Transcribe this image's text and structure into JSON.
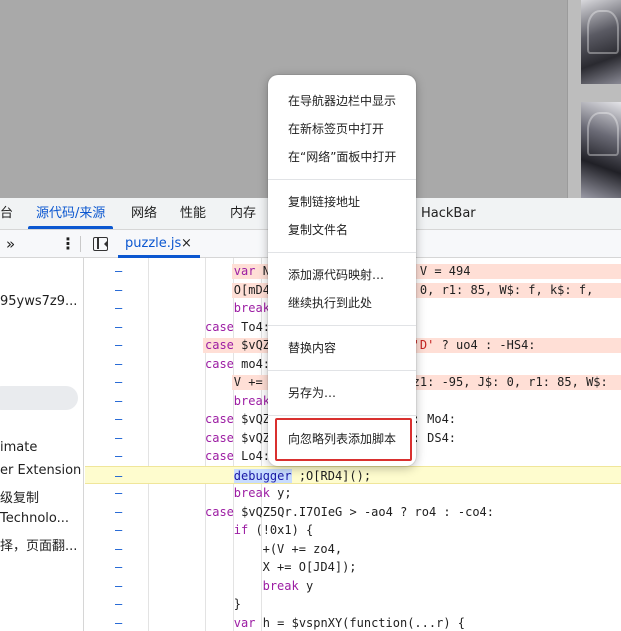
{
  "devtools_tabs": {
    "t0": "台",
    "sources": "源代码/来源",
    "network": "网络",
    "performance": "性能",
    "memory": "内存",
    "hackbar": "HackBar"
  },
  "toolbar": {
    "more_tabs_glyph": "»",
    "menu_glyph": "⋮",
    "file_tab_name": "puzzle.js",
    "file_tab_close": "×"
  },
  "navigator": {
    "items": [
      "95yws7z9...",
      "imate",
      "er Extension",
      "级复制",
      "Technolo...",
      "择，页面翻..."
    ]
  },
  "code_lines": [
    {
      "indent": "    ",
      "text": "var N",
      "tail": "se, V = 494"
    },
    {
      "indent": "    ",
      "text": "O[mD4",
      "tail": "J$: 0, r1: 85, W$: f, k$: f,"
    },
    {
      "indent": "    ",
      "text": "break",
      "tail": ""
    },
    {
      "indent": "",
      "text": "case To4:",
      "tail": ""
    },
    {
      "indent": "",
      "text": "case $vQZ",
      "tail": "== 'D' ? uo4 : -HS4:"
    },
    {
      "indent": "",
      "text": "case mo4:",
      "tail": ""
    },
    {
      "indent": "    ",
      "text": "V +=",
      "tail": "e {z1: -95, J$: 0, r1: 85, W$:"
    },
    {
      "indent": "    ",
      "text": "break",
      "tail": ""
    },
    {
      "indent": "",
      "text": "case $vQZ",
      "tail": "o4 : Mo4:"
    },
    {
      "indent": "",
      "text": "case $vQZ",
      "tail": "o4 : DS4:"
    },
    {
      "indent": "",
      "text": "case Lo4:",
      "tail": ""
    },
    {
      "indent": "    ",
      "text": "debugger ;O[RD4]();",
      "tail": ""
    },
    {
      "indent": "    ",
      "text": "break y;",
      "tail": ""
    },
    {
      "indent": "",
      "text": "case $vQZ5Qr.I7OIeG > -ao4 ? ro4 : -co4:",
      "tail": ""
    },
    {
      "indent": "    ",
      "text": "if (!0x1) {",
      "tail": ""
    },
    {
      "indent": "        ",
      "text": "+(V += zo4,",
      "tail": ""
    },
    {
      "indent": "        ",
      "text": "X += O[JD4]);",
      "tail": ""
    },
    {
      "indent": "        ",
      "text": "break y",
      "tail": ""
    },
    {
      "indent": "    ",
      "text": "}",
      "tail": ""
    },
    {
      "indent": "    ",
      "text": "var h = $vspnXY(function(...r) {",
      "tail": ""
    }
  ],
  "gutter_marker": "–",
  "context_menu": {
    "items": [
      "在导航器边栏中显示",
      "在新标签页中打开",
      "在“网络”面板中打开",
      "复制链接地址",
      "复制文件名",
      "添加源代码映射…",
      "继续执行到此处",
      "替换内容",
      "另存为…",
      "向忽略列表添加脚本"
    ],
    "highlighted_item": "向忽略列表添加脚本"
  }
}
